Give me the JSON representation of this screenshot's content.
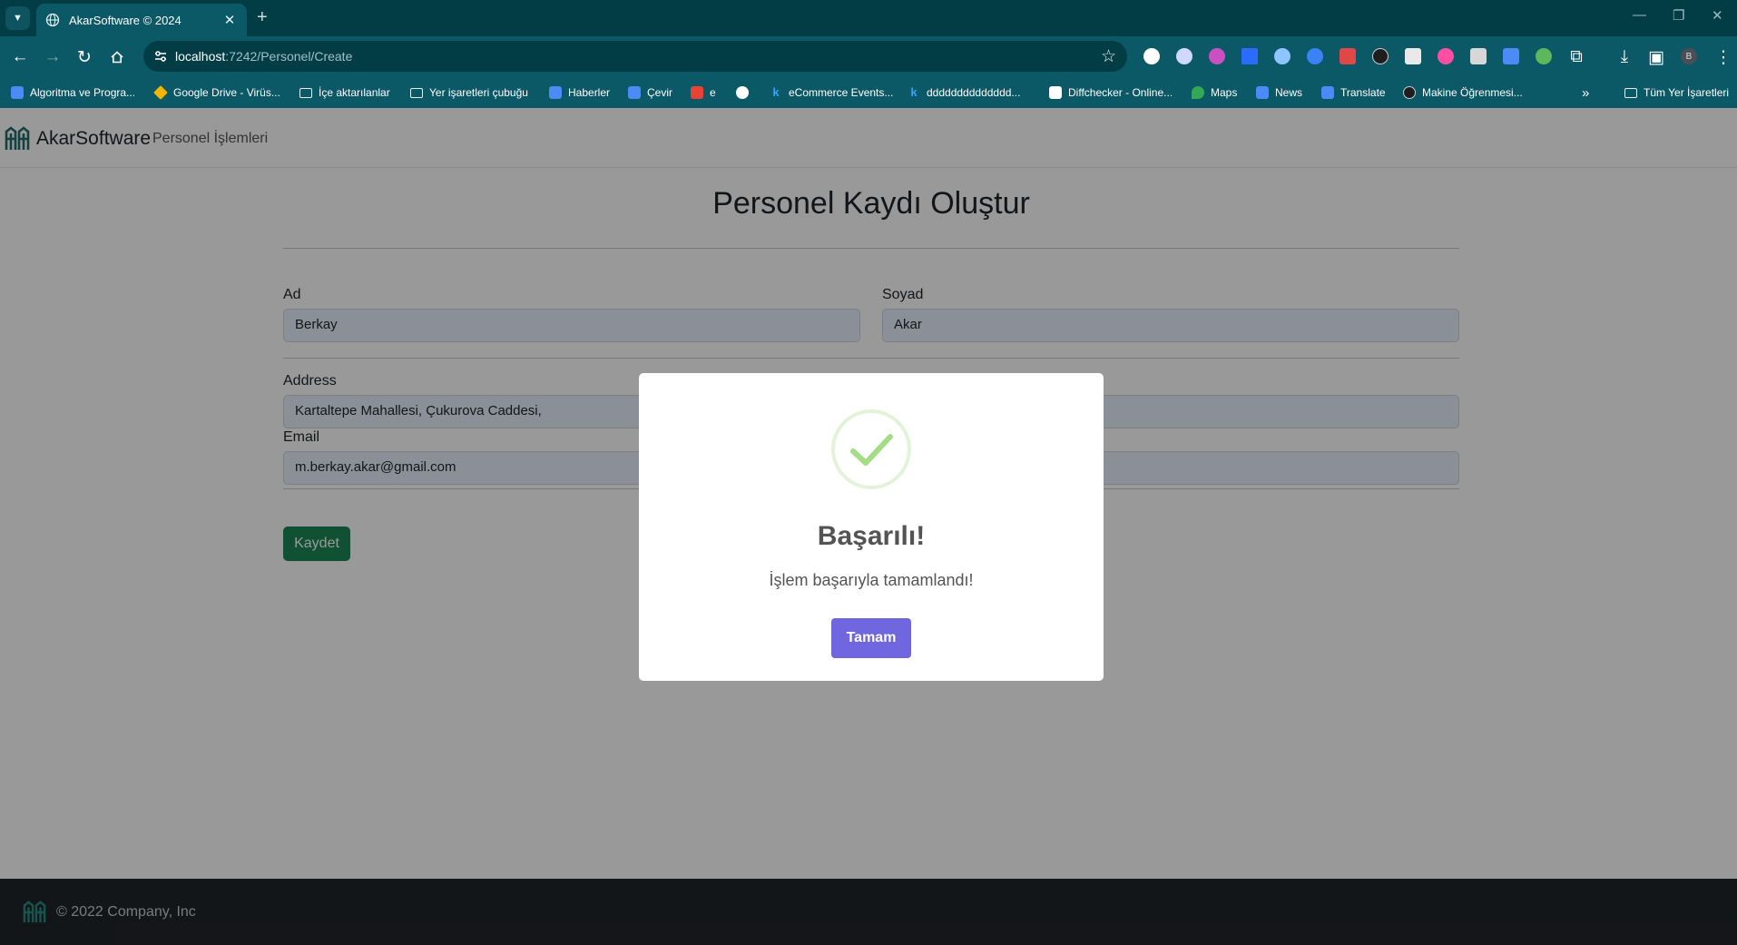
{
  "browser": {
    "tab": {
      "title": "AkarSoftware © 2024",
      "close": "✕"
    },
    "new_tab": "+",
    "window_controls": {
      "minimize": "—",
      "restore": "❐",
      "close": "✕"
    },
    "url": {
      "host": "localhost",
      "path": ":7242/Personel/Create"
    },
    "bookmarks": [
      {
        "label": "Algoritma ve Progra...",
        "icon": "bookmark-favicon",
        "color": "#4c8bf5"
      },
      {
        "label": "Google Drive - Virüs...",
        "icon": "google-drive-icon",
        "color": "#f4b400"
      },
      {
        "label": "İçe aktarılanlar",
        "icon": "folder-icon"
      },
      {
        "label": "Yer işaretleri çubuğu",
        "icon": "folder-icon"
      },
      {
        "label": "Haberler",
        "icon": "google-translate-icon",
        "color": "#4c8bf5"
      },
      {
        "label": "Çevir",
        "icon": "google-translate-icon",
        "color": "#4c8bf5"
      },
      {
        "label": "e",
        "icon": "gmail-icon",
        "color": "#ea4335"
      },
      {
        "label": "",
        "icon": "globe-icon",
        "color": "#ffffff"
      },
      {
        "label": "eCommerce Events...",
        "icon": "k-icon",
        "color": "#3aa0ff"
      },
      {
        "label": "dddddddddddddd...",
        "icon": "k-icon",
        "color": "#3aa0ff"
      },
      {
        "label": "Diffchecker - Online...",
        "icon": "diffchecker-icon",
        "color": "#ffffff"
      },
      {
        "label": "Maps",
        "icon": "maps-icon",
        "color": "#34a853"
      },
      {
        "label": "News",
        "icon": "google-translate-icon",
        "color": "#4c8bf5"
      },
      {
        "label": "Translate",
        "icon": "google-translate-icon",
        "color": "#4c8bf5"
      },
      {
        "label": "Makine Öğrenmesi...",
        "icon": "wordpress-icon",
        "color": "#1e1e1e"
      }
    ],
    "more_bookmarks": "»",
    "other_bookmarks": "Tüm Yer İşaretleri",
    "profile_initial": "B"
  },
  "navbar": {
    "brand": "AkarSoftware",
    "link": "Personel İşlemleri"
  },
  "form": {
    "title": "Personel Kaydı Oluştur",
    "first_name": {
      "label": "Ad",
      "value": "Berkay"
    },
    "last_name": {
      "label": "Soyad",
      "value": "Akar"
    },
    "address": {
      "label": "Address",
      "value": "Kartaltepe Mahallesi, Çukurova Caddesi,"
    },
    "email": {
      "label": "Email",
      "value": "m.berkay.akar@gmail.com"
    },
    "submit": "Kaydet"
  },
  "footer": {
    "text": "© 2022 Company, Inc"
  },
  "modal": {
    "title": "Başarılı!",
    "text": "İşlem başarıyla tamamlandı!",
    "confirm": "Tamam"
  },
  "colors": {
    "chrome": "#0b5866",
    "save_button": "#198754",
    "modal_button": "#7066e0",
    "success": "#a5dc86"
  }
}
